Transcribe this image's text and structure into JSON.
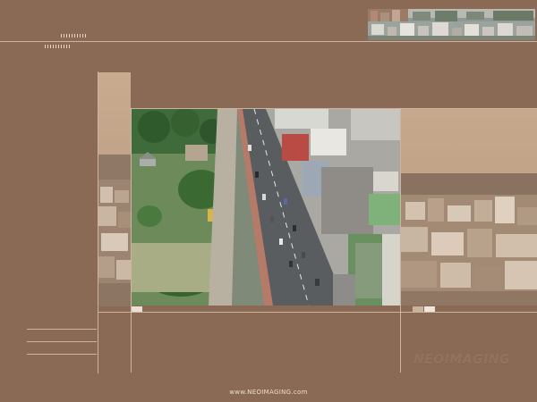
{
  "watermark_text": "NEOIMAGING",
  "footer_text": "www.NEOIMAGING.com",
  "colors": {
    "background": "#8a6a55",
    "line": "#e1cdb9",
    "sepia": "#b89a80",
    "footer_text": "#f0dcc8"
  },
  "images": {
    "top_right": "city-rooftops-photo",
    "main": "aerial-street-photo",
    "left_strip": "sepia-city-strip-photo",
    "right_panel": "sepia-city-skyline-photo"
  }
}
